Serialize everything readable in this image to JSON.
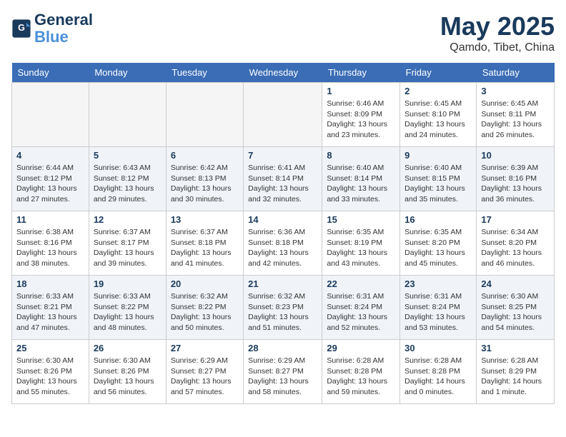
{
  "header": {
    "logo_line1": "General",
    "logo_line2": "Blue",
    "title": "May 2025",
    "subtitle": "Qamdo, Tibet, China"
  },
  "calendar": {
    "days_of_week": [
      "Sunday",
      "Monday",
      "Tuesday",
      "Wednesday",
      "Thursday",
      "Friday",
      "Saturday"
    ],
    "weeks": [
      {
        "row_class": "week-row-odd",
        "days": [
          {
            "num": "",
            "info": "",
            "empty": true
          },
          {
            "num": "",
            "info": "",
            "empty": true
          },
          {
            "num": "",
            "info": "",
            "empty": true
          },
          {
            "num": "",
            "info": "",
            "empty": true
          },
          {
            "num": "1",
            "info": "Sunrise: 6:46 AM\nSunset: 8:09 PM\nDaylight: 13 hours\nand 23 minutes.",
            "empty": false
          },
          {
            "num": "2",
            "info": "Sunrise: 6:45 AM\nSunset: 8:10 PM\nDaylight: 13 hours\nand 24 minutes.",
            "empty": false
          },
          {
            "num": "3",
            "info": "Sunrise: 6:45 AM\nSunset: 8:11 PM\nDaylight: 13 hours\nand 26 minutes.",
            "empty": false
          }
        ]
      },
      {
        "row_class": "week-row-even",
        "days": [
          {
            "num": "4",
            "info": "Sunrise: 6:44 AM\nSunset: 8:12 PM\nDaylight: 13 hours\nand 27 minutes.",
            "empty": false
          },
          {
            "num": "5",
            "info": "Sunrise: 6:43 AM\nSunset: 8:12 PM\nDaylight: 13 hours\nand 29 minutes.",
            "empty": false
          },
          {
            "num": "6",
            "info": "Sunrise: 6:42 AM\nSunset: 8:13 PM\nDaylight: 13 hours\nand 30 minutes.",
            "empty": false
          },
          {
            "num": "7",
            "info": "Sunrise: 6:41 AM\nSunset: 8:14 PM\nDaylight: 13 hours\nand 32 minutes.",
            "empty": false
          },
          {
            "num": "8",
            "info": "Sunrise: 6:40 AM\nSunset: 8:14 PM\nDaylight: 13 hours\nand 33 minutes.",
            "empty": false
          },
          {
            "num": "9",
            "info": "Sunrise: 6:40 AM\nSunset: 8:15 PM\nDaylight: 13 hours\nand 35 minutes.",
            "empty": false
          },
          {
            "num": "10",
            "info": "Sunrise: 6:39 AM\nSunset: 8:16 PM\nDaylight: 13 hours\nand 36 minutes.",
            "empty": false
          }
        ]
      },
      {
        "row_class": "week-row-odd",
        "days": [
          {
            "num": "11",
            "info": "Sunrise: 6:38 AM\nSunset: 8:16 PM\nDaylight: 13 hours\nand 38 minutes.",
            "empty": false
          },
          {
            "num": "12",
            "info": "Sunrise: 6:37 AM\nSunset: 8:17 PM\nDaylight: 13 hours\nand 39 minutes.",
            "empty": false
          },
          {
            "num": "13",
            "info": "Sunrise: 6:37 AM\nSunset: 8:18 PM\nDaylight: 13 hours\nand 41 minutes.",
            "empty": false
          },
          {
            "num": "14",
            "info": "Sunrise: 6:36 AM\nSunset: 8:18 PM\nDaylight: 13 hours\nand 42 minutes.",
            "empty": false
          },
          {
            "num": "15",
            "info": "Sunrise: 6:35 AM\nSunset: 8:19 PM\nDaylight: 13 hours\nand 43 minutes.",
            "empty": false
          },
          {
            "num": "16",
            "info": "Sunrise: 6:35 AM\nSunset: 8:20 PM\nDaylight: 13 hours\nand 45 minutes.",
            "empty": false
          },
          {
            "num": "17",
            "info": "Sunrise: 6:34 AM\nSunset: 8:20 PM\nDaylight: 13 hours\nand 46 minutes.",
            "empty": false
          }
        ]
      },
      {
        "row_class": "week-row-even",
        "days": [
          {
            "num": "18",
            "info": "Sunrise: 6:33 AM\nSunset: 8:21 PM\nDaylight: 13 hours\nand 47 minutes.",
            "empty": false
          },
          {
            "num": "19",
            "info": "Sunrise: 6:33 AM\nSunset: 8:22 PM\nDaylight: 13 hours\nand 48 minutes.",
            "empty": false
          },
          {
            "num": "20",
            "info": "Sunrise: 6:32 AM\nSunset: 8:22 PM\nDaylight: 13 hours\nand 50 minutes.",
            "empty": false
          },
          {
            "num": "21",
            "info": "Sunrise: 6:32 AM\nSunset: 8:23 PM\nDaylight: 13 hours\nand 51 minutes.",
            "empty": false
          },
          {
            "num": "22",
            "info": "Sunrise: 6:31 AM\nSunset: 8:24 PM\nDaylight: 13 hours\nand 52 minutes.",
            "empty": false
          },
          {
            "num": "23",
            "info": "Sunrise: 6:31 AM\nSunset: 8:24 PM\nDaylight: 13 hours\nand 53 minutes.",
            "empty": false
          },
          {
            "num": "24",
            "info": "Sunrise: 6:30 AM\nSunset: 8:25 PM\nDaylight: 13 hours\nand 54 minutes.",
            "empty": false
          }
        ]
      },
      {
        "row_class": "week-row-odd",
        "days": [
          {
            "num": "25",
            "info": "Sunrise: 6:30 AM\nSunset: 8:26 PM\nDaylight: 13 hours\nand 55 minutes.",
            "empty": false
          },
          {
            "num": "26",
            "info": "Sunrise: 6:30 AM\nSunset: 8:26 PM\nDaylight: 13 hours\nand 56 minutes.",
            "empty": false
          },
          {
            "num": "27",
            "info": "Sunrise: 6:29 AM\nSunset: 8:27 PM\nDaylight: 13 hours\nand 57 minutes.",
            "empty": false
          },
          {
            "num": "28",
            "info": "Sunrise: 6:29 AM\nSunset: 8:27 PM\nDaylight: 13 hours\nand 58 minutes.",
            "empty": false
          },
          {
            "num": "29",
            "info": "Sunrise: 6:28 AM\nSunset: 8:28 PM\nDaylight: 13 hours\nand 59 minutes.",
            "empty": false
          },
          {
            "num": "30",
            "info": "Sunrise: 6:28 AM\nSunset: 8:28 PM\nDaylight: 14 hours\nand 0 minutes.",
            "empty": false
          },
          {
            "num": "31",
            "info": "Sunrise: 6:28 AM\nSunset: 8:29 PM\nDaylight: 14 hours\nand 1 minute.",
            "empty": false
          }
        ]
      }
    ]
  }
}
